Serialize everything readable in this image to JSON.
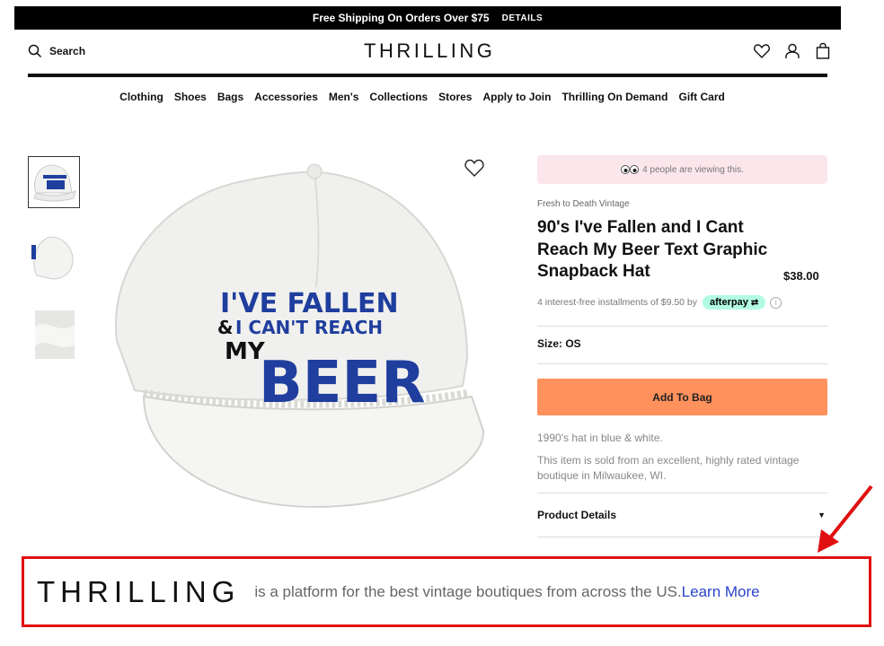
{
  "banner": {
    "text": "Free Shipping On Orders Over $75",
    "details": "DETAILS"
  },
  "header": {
    "search_label": "Search",
    "logo": "THRILLING"
  },
  "nav": [
    "Clothing",
    "Shoes",
    "Bags",
    "Accessories",
    "Men's",
    "Collections",
    "Stores",
    "Apply to Join",
    "Thrilling On Demand",
    "Gift Card"
  ],
  "product": {
    "viewing_text": "4 people are viewing this.",
    "vendor": "Fresh to Death Vintage",
    "title": "90's I've Fallen and I Cant Reach My Beer Text Graphic Snapback Hat",
    "price": "$38.00",
    "afterpay_text": "4 interest-free installments of $9.50 by",
    "afterpay_badge": "afterpay",
    "size_label": "Size: OS",
    "add_to_bag": "Add To Bag",
    "description_short": "1990's hat in blue & white.",
    "description_long": "This item is sold from an excellent, highly rated vintage boutique in Milwaukee, WI.",
    "details_label": "Product Details",
    "hat_text": {
      "line1": "I'VE FALLEN",
      "line2a": "&",
      "line2b": "I CAN'T REACH",
      "line3": "MY",
      "line4": "BEER"
    }
  },
  "footer": {
    "logo": "THRILLING",
    "text": "is a platform for the best vintage boutiques from across the US.",
    "link": "Learn More"
  },
  "colors": {
    "accent": "#ff915c",
    "viewing_bg": "#fbe6ec",
    "afterpay": "#b2fce4",
    "highlight": "#e01010",
    "link": "#2a43c9"
  }
}
